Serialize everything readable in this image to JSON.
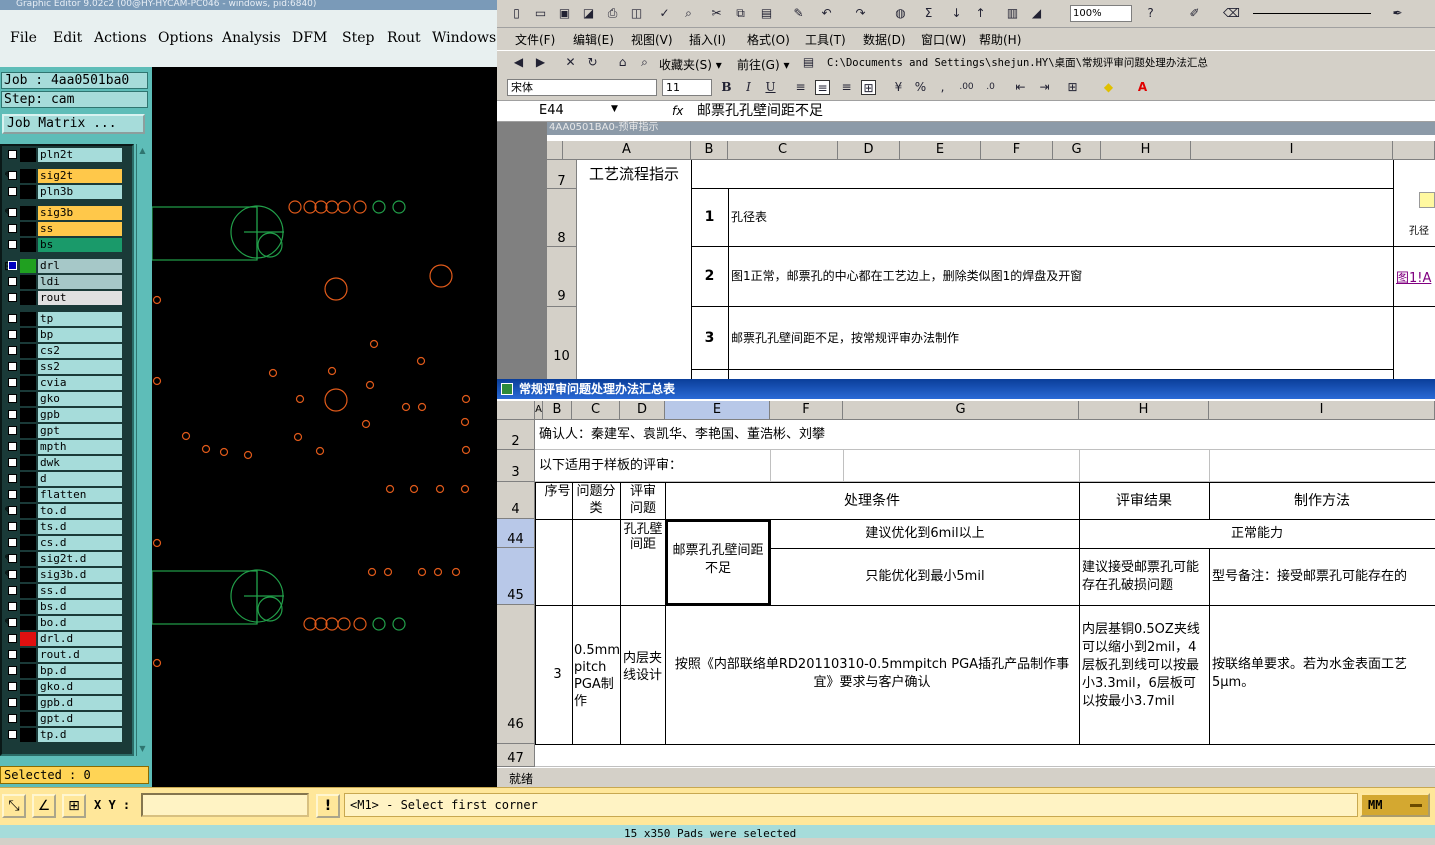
{
  "cam": {
    "title": "Graphic Editor 9.02c2 (00@HY-HYCAM-PC046 - windows, pid:6840)",
    "menu": [
      "File",
      "Edit",
      "Actions",
      "Options",
      "Analysis",
      "DFM",
      "Step",
      "Rout",
      "Windows"
    ],
    "job_label": "Job : 4aa0501ba0",
    "step_label": "Step: cam",
    "job_matrix_button": "Job Matrix ...",
    "selected_status": "Selected : 0",
    "layers": [
      {
        "name": "pln2t",
        "checked": false,
        "bg": "#a6dcda",
        "mark": ""
      },
      {
        "name": "sig2t",
        "checked": false,
        "bg": "#ffc84a",
        "mark": "✎"
      },
      {
        "name": "pln3b",
        "checked": false,
        "bg": "#a6dcda",
        "mark": ""
      },
      {
        "name": "sig3b",
        "checked": false,
        "bg": "#ffc84a",
        "mark": "✎"
      },
      {
        "name": "ss",
        "checked": false,
        "bg": "#ffc84a",
        "mark": ""
      },
      {
        "name": "bs",
        "checked": false,
        "bg": "#1a9a6a",
        "mark": ""
      },
      {
        "name": "drl",
        "checked": true,
        "bg": "#a6c8c8",
        "mark": "⊞",
        "swatch": "#20a020"
      },
      {
        "name": "ldi",
        "checked": false,
        "bg": "#a6c8c8",
        "mark": ""
      },
      {
        "name": "rout",
        "checked": false,
        "bg": "#e0e0e0",
        "mark": ""
      },
      {
        "name": "tp",
        "checked": false,
        "bg": "#a6dcda",
        "mark": ""
      },
      {
        "name": "bp",
        "checked": false,
        "bg": "#a6dcda",
        "mark": ""
      },
      {
        "name": "cs2",
        "checked": false,
        "bg": "#a6dcda",
        "mark": ""
      },
      {
        "name": "ss2",
        "checked": false,
        "bg": "#a6dcda",
        "mark": ""
      },
      {
        "name": "cvia",
        "checked": false,
        "bg": "#a6dcda",
        "mark": ""
      },
      {
        "name": "gko",
        "checked": false,
        "bg": "#a6dcda",
        "mark": ""
      },
      {
        "name": "gpb",
        "checked": false,
        "bg": "#a6dcda",
        "mark": ""
      },
      {
        "name": "gpt",
        "checked": false,
        "bg": "#a6dcda",
        "mark": ""
      },
      {
        "name": "mpth",
        "checked": false,
        "bg": "#a6dcda",
        "mark": ""
      },
      {
        "name": "dwk",
        "checked": false,
        "bg": "#a6dcda",
        "mark": ""
      },
      {
        "name": "d",
        "checked": false,
        "bg": "#a6dcda",
        "mark": ""
      },
      {
        "name": "flatten",
        "checked": false,
        "bg": "#a6dcda",
        "mark": ""
      },
      {
        "name": "to.d",
        "checked": false,
        "bg": "#a6dcda",
        "mark": "✎"
      },
      {
        "name": "ts.d",
        "checked": false,
        "bg": "#a6dcda",
        "mark": ""
      },
      {
        "name": "cs.d",
        "checked": false,
        "bg": "#a6dcda",
        "mark": ""
      },
      {
        "name": "sig2t.d",
        "checked": false,
        "bg": "#a6dcda",
        "mark": "✎"
      },
      {
        "name": "sig3b.d",
        "checked": false,
        "bg": "#a6dcda",
        "mark": "✎"
      },
      {
        "name": "ss.d",
        "checked": false,
        "bg": "#a6dcda",
        "mark": ""
      },
      {
        "name": "bs.d",
        "checked": false,
        "bg": "#a6dcda",
        "mark": ""
      },
      {
        "name": "bo.d",
        "checked": false,
        "bg": "#a6dcda",
        "mark": "✎"
      },
      {
        "name": "drl.d",
        "checked": false,
        "bg": "#a6dcda",
        "mark": "",
        "swatch": "#e01010"
      },
      {
        "name": "rout.d",
        "checked": false,
        "bg": "#a6dcda",
        "mark": ""
      },
      {
        "name": "bp.d",
        "checked": false,
        "bg": "#a6dcda",
        "mark": ""
      },
      {
        "name": "gko.d",
        "checked": false,
        "bg": "#a6dcda",
        "mark": ""
      },
      {
        "name": "gpb.d",
        "checked": false,
        "bg": "#a6dcda",
        "mark": ""
      },
      {
        "name": "gpt.d",
        "checked": false,
        "bg": "#a6dcda",
        "mark": ""
      },
      {
        "name": "tp.d",
        "checked": false,
        "bg": "#a6dcda",
        "mark": ""
      }
    ]
  },
  "excel": {
    "zoom": "100%",
    "menu": [
      "文件(F)",
      "编辑(E)",
      "视图(V)",
      "插入(I)",
      "格式(O)",
      "工具(T)",
      "数据(D)",
      "窗口(W)",
      "帮助(H)"
    ],
    "favorites": "收藏夹(S) ▾",
    "goto": "前往(G) ▾",
    "address": "C:\\Documents and Settings\\shejun.HY\\桌面\\常规评审问题处理办法汇总",
    "font_name": "宋体",
    "font_size": "11",
    "name_box": "E44",
    "fx": "fx",
    "formula": "邮票孔孔壁间距不足",
    "status": "就绪",
    "wb1": {
      "title": "4AA0501BA0-预审指示",
      "cols": [
        "A",
        "B",
        "C",
        "D",
        "E",
        "F",
        "G",
        "H",
        "I"
      ],
      "rows": [
        "7",
        "8",
        "9",
        "10"
      ],
      "header_cell": "工艺流程指示",
      "items": [
        {
          "num": "1",
          "text": "孔径表"
        },
        {
          "num": "2",
          "text": "图1正常，邮票孔的中心都在工艺边上，删除类似图1的焊盘及开窗"
        },
        {
          "num": "3",
          "text": "邮票孔孔壁间距不足，按常规评审办法制作"
        }
      ],
      "link": "图1!A",
      "icon_label": "孔径"
    },
    "wb2": {
      "title": "常规评审问题处理办法汇总表",
      "cols": [
        "A",
        "B",
        "C",
        "D",
        "E",
        "F",
        "G",
        "H",
        "I"
      ],
      "rows": [
        "2",
        "3",
        "4",
        "44",
        "45",
        "46",
        "47"
      ],
      "confirm": "确认人：秦建军、袁凯华、李艳国、董浩彬、刘攀",
      "scope": "以下适用于样板的评审：",
      "h_seq": "序号",
      "h_cat": "问题分类",
      "h_issue": "评审问题",
      "h_cond": "处理条件",
      "h_result": "评审结果",
      "h_method": "制作方法",
      "r44_issue": "孔孔壁间距",
      "r44_e": "邮票孔孔壁间距不足",
      "r44_g": "建议优化到6mil以上",
      "r44_h": "正常能力",
      "r45_g": "只能优化到最小5mil",
      "r45_h": "建议接受邮票孔可能存在孔破损问题",
      "r45_i": "型号备注：接受邮票孔可能存在的",
      "r46_seq": "3",
      "r46_cat": "0.5mm pitch PGA制作",
      "r46_issue": "内层夹线设计",
      "r46_e": "按照《内部联络单RD20110310-0.5mmpitch PGA插孔产品制作事宜》要求与客户确认",
      "r46_h": "内层基铜0.5OZ夹线可以缩小到2mil，4层板孔到线可以按最小3.3mil，6层板可以按最小3.7mil",
      "r46_i": "按联络单要求。若为水金表面工艺5μm。"
    }
  },
  "cmd": {
    "xy_label": "X Y :",
    "xy_value": "",
    "prompt": "<M1> - Select first corner",
    "units": "MM",
    "message": "15 x350 Pads were selected"
  }
}
